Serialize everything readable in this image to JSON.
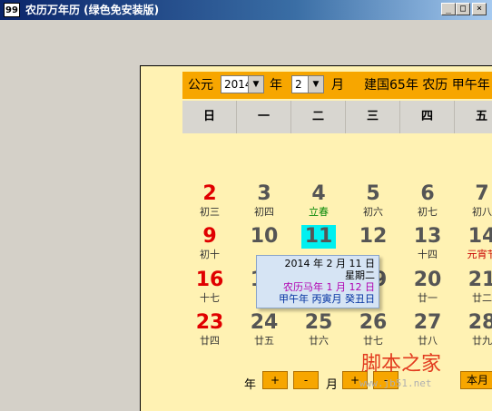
{
  "window": {
    "icon_text": "99",
    "title": "农历万年历 (绿色免安装版)",
    "minimize": "_",
    "maximize": "□",
    "close": "×"
  },
  "header": {
    "gregorian_label": "公元",
    "year_value": "2014",
    "year_unit": "年",
    "month_value": "2",
    "month_unit": "月",
    "era_label": "建国65年 农历 甲午年"
  },
  "weekdays": [
    "日",
    "一",
    "二",
    "三",
    "四",
    "五"
  ],
  "rows": [
    [
      {
        "day": "2",
        "lunar": "初三",
        "red": true
      },
      {
        "day": "3",
        "lunar": "初四"
      },
      {
        "day": "4",
        "lunar": "立春",
        "term": true
      },
      {
        "day": "5",
        "lunar": "初六"
      },
      {
        "day": "6",
        "lunar": "初七"
      },
      {
        "day": "7",
        "lunar": "初八"
      }
    ],
    [
      {
        "day": "9",
        "lunar": "初十",
        "red": true
      },
      {
        "day": "10",
        "lunar": ""
      },
      {
        "day": "11",
        "lunar": "",
        "today": true
      },
      {
        "day": "12",
        "lunar": ""
      },
      {
        "day": "13",
        "lunar": "十四"
      },
      {
        "day": "14",
        "lunar": "元宵节",
        "fest": true
      }
    ],
    [
      {
        "day": "16",
        "lunar": "十七",
        "red": true
      },
      {
        "day": "17",
        "lunar": ""
      },
      {
        "day": "18",
        "lunar": ""
      },
      {
        "day": "19",
        "lunar": ""
      },
      {
        "day": "20",
        "lunar": "廿一"
      },
      {
        "day": "21",
        "lunar": "廿二"
      }
    ],
    [
      {
        "day": "23",
        "lunar": "廿四",
        "red": true
      },
      {
        "day": "24",
        "lunar": "廿五"
      },
      {
        "day": "25",
        "lunar": "廿六"
      },
      {
        "day": "26",
        "lunar": "廿七"
      },
      {
        "day": "27",
        "lunar": "廿八"
      },
      {
        "day": "28",
        "lunar": "廿九"
      }
    ]
  ],
  "tooltip": {
    "date": "2014 年 2 月 11 日",
    "weekday": "星期二",
    "lunar": "农历马年 1 月 12 日",
    "ganzhi": "甲午年 丙寅月 癸丑日"
  },
  "bottom": {
    "year_label": "年",
    "plus": "+",
    "minus": "-",
    "month_label": "月",
    "this_month": "本月"
  },
  "watermark": {
    "text": "脚本之家",
    "url": "www.jb51.net"
  },
  "colors": {
    "header_orange": "#f7a600",
    "calendar_bg": "#fff2b3",
    "sunday_red": "#e00000",
    "today_cyan": "#00f0f0",
    "solar_term_green": "#0a8a0a"
  }
}
